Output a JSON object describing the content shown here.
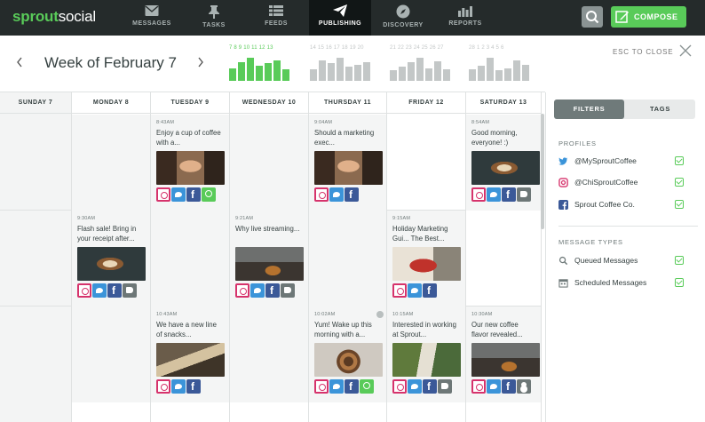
{
  "app": {
    "logo_bold": "sprout",
    "logo_light": "social"
  },
  "nav": [
    {
      "label": "MESSAGES",
      "icon": "envelope-icon"
    },
    {
      "label": "TASKS",
      "icon": "pin-icon"
    },
    {
      "label": "FEEDS",
      "icon": "list-icon"
    },
    {
      "label": "PUBLISHING",
      "icon": "paper-plane-icon",
      "active": true
    },
    {
      "label": "DISCOVERY",
      "icon": "compass-icon"
    },
    {
      "label": "REPORTS",
      "icon": "bar-chart-icon"
    }
  ],
  "toolbar": {
    "compose_label": "COMPOSE"
  },
  "header": {
    "week_title": "Week of February 7",
    "esc_label": "ESC TO CLOSE"
  },
  "mini_weeks": [
    {
      "days": "7 8 9 10 11 12 13",
      "current": true,
      "bars": [
        0.55,
        0.8,
        1.0,
        0.65,
        0.75,
        0.9,
        0.5
      ]
    },
    {
      "days": "14 15 16 17 18 19 20",
      "current": false,
      "bars": [
        0.5,
        0.9,
        0.75,
        1.0,
        0.6,
        0.7,
        0.8
      ]
    },
    {
      "days": "21 22 23 24 25 26 27",
      "current": false,
      "bars": [
        0.45,
        0.6,
        0.8,
        1.0,
        0.55,
        0.85,
        0.5
      ]
    },
    {
      "days": "28 1 2 3 4 5 6",
      "current": false,
      "bars": [
        0.5,
        0.65,
        1.0,
        0.45,
        0.55,
        0.9,
        0.7
      ]
    }
  ],
  "days": [
    "SUNDAY 7",
    "MONDAY 8",
    "TUESDAY 9",
    "WEDNESDAY 10",
    "THURSDAY 11",
    "FRIDAY 12",
    "SATURDAY 13"
  ],
  "posts": [
    {
      "day": 2,
      "row": 0,
      "time": "8:43AM",
      "text": "Enjoy a cup of coffee with a...",
      "img": "img-face",
      "icons": [
        "ig",
        "tw",
        "fb",
        "q"
      ]
    },
    {
      "day": 4,
      "row": 0,
      "time": "9:04AM",
      "text": "Should a marketing exec...",
      "img": "img-face",
      "icons": [
        "ig",
        "tw",
        "fb"
      ]
    },
    {
      "day": 6,
      "row": 0,
      "time": "8:54AM",
      "text": "Good morning, everyone! :)",
      "img": "img-latte",
      "icons": [
        "ig",
        "tw",
        "fb",
        "tg"
      ]
    },
    {
      "day": 1,
      "row": 1,
      "time": "9:30AM",
      "text": "Flash sale! Bring in your receipt after...",
      "img": "img-latte",
      "icons": [
        "ig",
        "tw",
        "fb",
        "tg"
      ]
    },
    {
      "day": 3,
      "row": 1,
      "time": "9:21AM",
      "text": "Why live streaming...",
      "img": "img-espresso",
      "icons": [
        "ig",
        "tw",
        "fb",
        "tg"
      ]
    },
    {
      "day": 5,
      "row": 1,
      "time": "9:15AM",
      "text": "Holiday Marketing Gui... The Best...",
      "img": "img-red",
      "icons": [
        "ig",
        "tw",
        "fb"
      ]
    },
    {
      "day": 2,
      "row": 2,
      "time": "10:43AM",
      "text": "We have a new line of snacks...",
      "img": "img-snack",
      "icons": [
        "ig",
        "tw",
        "fb"
      ]
    },
    {
      "day": 4,
      "row": 2,
      "time": "10:02AM",
      "text": "Yum! Wake up this morning with a...",
      "img": "img-roll",
      "icons": [
        "ig",
        "tw",
        "fb",
        "q"
      ]
    },
    {
      "day": 5,
      "row": 2,
      "time": "10:15AM",
      "text": "Interested in working at Sprout...",
      "img": "img-green",
      "icons": [
        "ig",
        "tw",
        "fb",
        "tg"
      ]
    },
    {
      "day": 6,
      "row": 2,
      "time": "10:30AM",
      "text": "Our new coffee flavor revealed...",
      "img": "img-espresso",
      "icons": [
        "ig",
        "tw",
        "fb",
        "us"
      ]
    }
  ],
  "panel": {
    "tab_filters": "FILTERS",
    "tab_tags": "TAGS",
    "profiles_heading": "PROFILES",
    "profiles": [
      {
        "name": "@MySproutCoffee",
        "network": "twitter",
        "checked": true
      },
      {
        "name": "@ChiSproutCoffee",
        "network": "instagram",
        "checked": true
      },
      {
        "name": "Sprout Coffee Co.",
        "network": "facebook",
        "checked": true
      }
    ],
    "types_heading": "MESSAGE TYPES",
    "types": [
      {
        "name": "Queued Messages",
        "icon": "search-icon",
        "checked": true
      },
      {
        "name": "Scheduled Messages",
        "icon": "calendar-icon",
        "checked": true
      }
    ]
  },
  "colors": {
    "topbar": "#252b2b",
    "accent": "#59cb59",
    "instagram": "#d6336c",
    "twitter": "#3b94d9",
    "facebook": "#3b5998"
  }
}
